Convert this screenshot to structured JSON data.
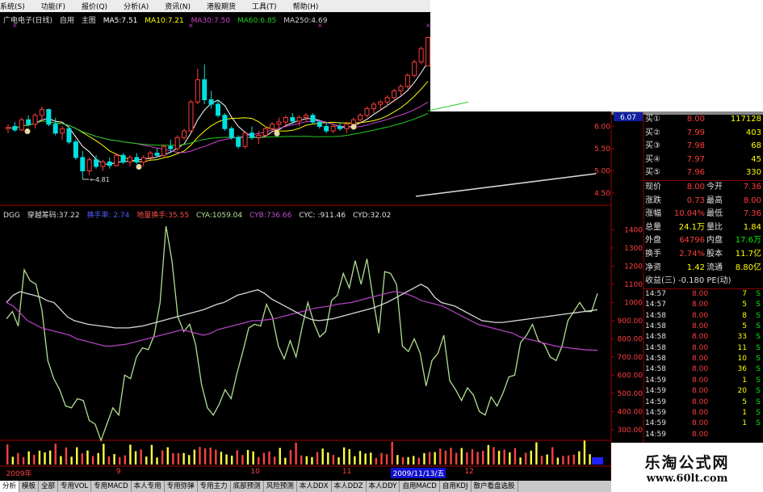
{
  "menubar": [
    "系统(S)",
    "功能(F)",
    "报价(Q)",
    "分析(A)",
    "资讯(N)",
    "港股期货",
    "工具(T)",
    "帮助(H)"
  ],
  "header": {
    "stock": "广电电子(日线)",
    "self": "自用",
    "main": "主图",
    "ma5": "MA5:7.51",
    "ma10": "MA10:7.21",
    "ma30": "MA30:7.50",
    "ma60": "MA60:6.85",
    "ma250": "MA250:4.69"
  },
  "indicator_header": {
    "name": "DGG",
    "chip": "穿越筹码:37.22",
    "turnover": "换手率: 2.74",
    "grounded": "地量换手:35.55",
    "cya": "CYA:1059.04",
    "cyb": "CYB:736.66",
    "cyc": "CYC: :911.46",
    "cyd": "CYD:32.02"
  },
  "colors": {
    "up": "#ff3c3c",
    "down": "#00e0e0",
    "ma5": "#ffffff",
    "ma10": "#ffff00",
    "ma30": "#cc44cc",
    "ma60": "#22cc22",
    "cya": "#b0e090",
    "cyb": "#b040c0",
    "cyc": "#d8d8d8",
    "highlight": "#3a3aff"
  },
  "quote": {
    "buy": [
      {
        "label": "买①",
        "price": "8.00",
        "vol": "117128"
      },
      {
        "label": "买②",
        "price": "7.99",
        "vol": "403"
      },
      {
        "label": "买③",
        "price": "7.98",
        "vol": "68"
      },
      {
        "label": "买④",
        "price": "7.97",
        "vol": "45"
      },
      {
        "label": "买⑤",
        "price": "7.96",
        "vol": "330"
      }
    ],
    "stats": [
      {
        "k1": "现价",
        "v1": "8.00",
        "k2": "今开",
        "v2": "7.36"
      },
      {
        "k1": "涨跌",
        "v1": "0.73",
        "k2": "最高",
        "v2": "8.00"
      },
      {
        "k1": "涨幅",
        "v1": "10.04%",
        "k2": "最低",
        "v2": "7.36"
      },
      {
        "k1": "总量",
        "v1": "24.1万",
        "k2": "量比",
        "v2": "1.84"
      },
      {
        "k1": "外盘",
        "v1": "64796",
        "k2": "内盘",
        "v2": "17.6万"
      },
      {
        "k1": "换手",
        "v1": "2.74%",
        "k2": "股本",
        "v2": "11.7亿"
      },
      {
        "k1": "净资",
        "v1": "1.42",
        "k2": "流通",
        "v2": "8.80亿"
      }
    ],
    "earnings": "收益(三) -0.180 PE(动)",
    "trades": [
      {
        "t": "14:57",
        "p": "8.00",
        "v": "7",
        "s": "S"
      },
      {
        "t": "14:57",
        "p": "8.00",
        "v": "5",
        "s": "S"
      },
      {
        "t": "14:58",
        "p": "8.00",
        "v": "8",
        "s": "S"
      },
      {
        "t": "14:58",
        "p": "8.00",
        "v": "5",
        "s": "S"
      },
      {
        "t": "14:58",
        "p": "8.00",
        "v": "33",
        "s": "S"
      },
      {
        "t": "14:58",
        "p": "8.00",
        "v": "11",
        "s": "S"
      },
      {
        "t": "14:58",
        "p": "8.00",
        "v": "10",
        "s": "S"
      },
      {
        "t": "14:58",
        "p": "8.00",
        "v": "36",
        "s": "S"
      },
      {
        "t": "14:59",
        "p": "8.00",
        "v": "1",
        "s": "S"
      },
      {
        "t": "14:59",
        "p": "8.00",
        "v": "20",
        "s": "S"
      },
      {
        "t": "14:59",
        "p": "8.00",
        "v": "5",
        "s": "S"
      },
      {
        "t": "14:59",
        "p": "8.00",
        "v": "1",
        "s": "S"
      },
      {
        "t": "14:59",
        "p": "8.00",
        "v": "1",
        "s": "S"
      },
      {
        "t": "14:59",
        "p": "8.00",
        "v": "",
        "s": ""
      }
    ]
  },
  "watermark": {
    "title": "乐淘公式网",
    "url": "www.60lt.com"
  },
  "dates": [
    {
      "text": "2009年",
      "pos": 0.01
    },
    {
      "text": "9",
      "pos": 0.19
    },
    {
      "text": "10",
      "pos": 0.41
    },
    {
      "text": "11",
      "pos": 0.56
    },
    {
      "text": "2009/11/13/五",
      "pos": 0.64,
      "hl": true
    },
    {
      "text": "12",
      "pos": 0.76
    }
  ],
  "tabs": [
    "分析",
    "模板",
    "全部",
    "专用VOL",
    "专用MACD",
    "本人专用",
    "专用弥弹",
    "专用主力",
    "底部预测",
    "风险预测",
    "本人DDX",
    "本人DDZ",
    "本人DDY",
    "自用MACD",
    "自用KDJ",
    "散户看盘选股"
  ],
  "chart_data": [
    {
      "type": "candlestick",
      "title": "广电电子(日线)",
      "y_ticks": [
        "6.00",
        "5.50",
        "5.00",
        "4.50"
      ],
      "current_price_label": "6.07",
      "low_annotation": "4.81",
      "ylim": [
        4.3,
        8.3
      ],
      "ohlc": [
        [
          5.95,
          6.05,
          5.85,
          5.98
        ],
        [
          6.0,
          6.1,
          5.88,
          5.92
        ],
        [
          5.92,
          6.2,
          5.9,
          6.15
        ],
        [
          6.15,
          6.25,
          6.0,
          6.05
        ],
        [
          6.05,
          6.3,
          5.95,
          6.25
        ],
        [
          6.25,
          6.45,
          6.1,
          6.38
        ],
        [
          6.38,
          6.4,
          6.0,
          6.05
        ],
        [
          6.05,
          6.2,
          5.8,
          5.85
        ],
        [
          5.85,
          6.0,
          5.7,
          5.95
        ],
        [
          5.95,
          6.0,
          5.6,
          5.65
        ],
        [
          5.65,
          5.7,
          5.25,
          5.3
        ],
        [
          5.3,
          5.45,
          4.81,
          5.0
        ],
        [
          5.0,
          5.3,
          4.9,
          5.25
        ],
        [
          5.25,
          5.35,
          5.05,
          5.1
        ],
        [
          5.1,
          5.25,
          5.0,
          5.2
        ],
        [
          5.2,
          5.3,
          5.05,
          5.12
        ],
        [
          5.12,
          5.4,
          5.1,
          5.35
        ],
        [
          5.35,
          5.4,
          5.15,
          5.2
        ],
        [
          5.2,
          5.35,
          5.1,
          5.3
        ],
        [
          5.3,
          5.4,
          5.15,
          5.2
        ],
        [
          5.2,
          5.35,
          5.1,
          5.3
        ],
        [
          5.3,
          5.45,
          5.25,
          5.4
        ],
        [
          5.4,
          5.5,
          5.3,
          5.35
        ],
        [
          5.35,
          5.6,
          5.3,
          5.55
        ],
        [
          5.55,
          5.7,
          5.4,
          5.5
        ],
        [
          5.5,
          5.8,
          5.45,
          5.75
        ],
        [
          5.75,
          5.95,
          5.7,
          5.9
        ],
        [
          5.9,
          6.6,
          5.85,
          6.55
        ],
        [
          6.55,
          7.3,
          6.5,
          7.05
        ],
        [
          7.05,
          7.4,
          6.5,
          6.6
        ],
        [
          6.6,
          6.8,
          6.4,
          6.5
        ],
        [
          6.5,
          6.6,
          6.2,
          6.25
        ],
        [
          6.25,
          6.3,
          5.9,
          5.95
        ],
        [
          5.95,
          6.0,
          5.7,
          5.75
        ],
        [
          5.75,
          5.8,
          5.5,
          5.55
        ],
        [
          5.55,
          5.9,
          5.5,
          5.85
        ],
        [
          5.85,
          6.0,
          5.7,
          5.75
        ],
        [
          5.75,
          5.9,
          5.6,
          5.8
        ],
        [
          5.8,
          6.0,
          5.75,
          5.95
        ],
        [
          5.95,
          6.1,
          5.85,
          6.05
        ],
        [
          6.05,
          6.2,
          5.95,
          6.1
        ],
        [
          6.1,
          6.25,
          6.0,
          6.2
        ],
        [
          6.2,
          6.3,
          6.05,
          6.12
        ],
        [
          6.12,
          6.25,
          6.0,
          6.2
        ],
        [
          6.2,
          6.3,
          6.1,
          6.25
        ],
        [
          6.25,
          6.3,
          6.05,
          6.1
        ],
        [
          6.1,
          6.15,
          5.95,
          6.0
        ],
        [
          6.0,
          6.1,
          5.85,
          5.9
        ],
        [
          5.9,
          6.05,
          5.85,
          6.0
        ],
        [
          6.0,
          6.1,
          5.9,
          5.95
        ],
        [
          5.95,
          6.1,
          5.85,
          6.05
        ],
        [
          6.05,
          6.2,
          5.95,
          6.15
        ],
        [
          6.15,
          6.3,
          6.05,
          6.25
        ],
        [
          6.25,
          6.45,
          6.2,
          6.4
        ],
        [
          6.4,
          6.55,
          6.3,
          6.5
        ],
        [
          6.5,
          6.6,
          6.35,
          6.55
        ],
        [
          6.55,
          6.7,
          6.45,
          6.65
        ],
        [
          6.65,
          6.85,
          6.55,
          6.8
        ],
        [
          6.8,
          6.95,
          6.7,
          6.9
        ],
        [
          6.9,
          7.2,
          6.85,
          7.15
        ],
        [
          7.15,
          7.5,
          7.1,
          7.45
        ],
        [
          7.45,
          7.8,
          7.4,
          7.75
        ],
        [
          7.36,
          8.0,
          7.36,
          8.0
        ]
      ]
    },
    {
      "type": "line",
      "title": "DGG",
      "y_ticks": [
        "1400",
        "1300",
        "1200",
        "1100",
        "1000",
        "900.00",
        "800.00",
        "700.00",
        "600.00",
        "500.00",
        "400.00",
        "300.00"
      ],
      "ylim": [
        250,
        1500
      ],
      "series": [
        {
          "name": "CYA",
          "values": [
            910,
            950,
            870,
            1180,
            1120,
            1100,
            960,
            680,
            580,
            520,
            430,
            420,
            470,
            460,
            350,
            330,
            240,
            330,
            420,
            380,
            600,
            580,
            700,
            750,
            740,
            820,
            1000,
            1420,
            1230,
            920,
            840,
            880,
            770,
            550,
            420,
            380,
            440,
            520,
            470,
            610,
            730,
            860,
            880,
            870,
            990,
            920,
            760,
            690,
            790,
            700,
            860,
            1000,
            890,
            810,
            840,
            1010,
            1040,
            1160,
            1080,
            1230,
            1100,
            1240,
            1030,
            830,
            1170,
            1160,
            1100,
            760,
            730,
            800,
            720,
            540,
            680,
            720,
            820,
            570,
            520,
            460,
            530,
            490,
            400,
            380,
            480,
            430,
            500,
            590,
            600,
            780,
            820,
            880,
            790,
            770,
            700,
            680,
            760,
            900,
            950,
            1000,
            950,
            950,
            1050
          ]
        },
        {
          "name": "CYB",
          "values": [
            1000,
            980,
            940,
            900,
            880,
            860,
            850,
            840,
            830,
            820,
            800,
            790,
            780,
            770,
            760,
            760,
            765,
            770,
            780,
            790,
            800,
            810,
            820,
            830,
            840,
            850,
            840,
            830,
            820,
            830,
            850,
            860,
            870,
            880,
            890,
            900,
            900,
            905,
            910,
            920,
            930,
            940,
            950,
            960,
            970,
            975,
            980,
            990,
            995,
            1000,
            1010,
            1020,
            1030,
            1040,
            1050,
            1060,
            1055,
            1045,
            1030,
            1010,
            1000,
            990,
            980,
            960,
            940,
            920,
            900,
            880,
            870,
            860,
            850,
            840,
            830,
            810,
            800,
            790,
            780,
            770,
            760,
            755,
            750,
            745,
            740,
            738,
            736
          ]
        },
        {
          "name": "CYC",
          "values": [
            1050,
            1050,
            1050,
            1048,
            1046,
            1045,
            1044,
            1043,
            1042,
            1041,
            1040,
            1040,
            1040,
            1040,
            1040,
            1040,
            1040,
            1040,
            1040,
            1040,
            1040,
            1040,
            1040,
            1040,
            1040,
            1040,
            1040,
            1040,
            1040,
            1040,
            1040,
            1040,
            1040,
            1040,
            1040,
            1040,
            1040,
            1040,
            1040,
            1040,
            1040,
            1040,
            1040,
            1040,
            1040,
            1040,
            1040,
            1040,
            1040,
            1040,
            1040,
            1040,
            1040,
            1040,
            1040,
            1040,
            1040,
            1040,
            1040,
            1040,
            1040,
            1040,
            1040,
            1040,
            1040,
            1040,
            1040,
            1040,
            1040,
            1040,
            1040,
            1040,
            1040,
            1040,
            1040,
            1040,
            1040,
            1040,
            1040,
            1040,
            1040,
            1040,
            1040,
            1040,
            1040,
            1040,
            1040,
            1040,
            1040,
            1040,
            1040,
            1040,
            1040,
            1040,
            1040,
            1040,
            1040,
            1040,
            1040,
            1040,
            1040
          ]
        }
      ]
    }
  ]
}
